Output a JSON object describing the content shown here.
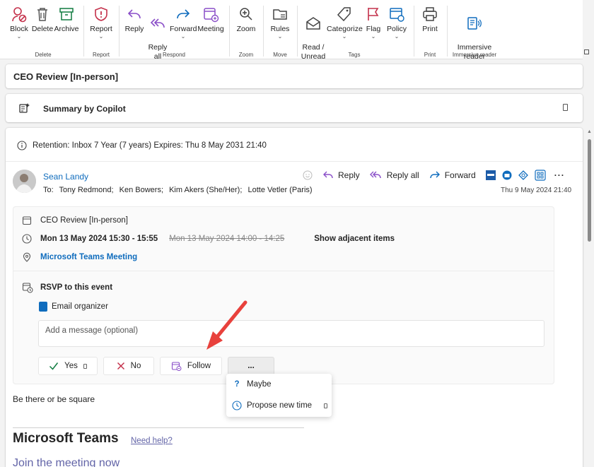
{
  "ribbon": {
    "groups": [
      {
        "name": "Delete",
        "buttons": [
          {
            "label": "Block",
            "icon": "block-icon",
            "chevron": true
          },
          {
            "label": "Delete",
            "icon": "delete-icon"
          },
          {
            "label": "Archive",
            "icon": "archive-icon"
          }
        ]
      },
      {
        "name": "Report",
        "buttons": [
          {
            "label": "Report",
            "icon": "report-icon",
            "chevron": true
          }
        ]
      },
      {
        "name": "Respond",
        "buttons": [
          {
            "label": "Reply",
            "icon": "reply-icon"
          },
          {
            "label": "Reply\nall",
            "icon": "reply-all-icon"
          },
          {
            "label": "Forward",
            "icon": "forward-icon",
            "chevron": true
          },
          {
            "label": "Meeting",
            "icon": "meeting-icon"
          }
        ]
      },
      {
        "name": "Zoom",
        "buttons": [
          {
            "label": "Zoom",
            "icon": "zoom-icon"
          }
        ]
      },
      {
        "name": "Move",
        "buttons": [
          {
            "label": "Rules",
            "icon": "rules-icon",
            "chevron": true
          }
        ]
      },
      {
        "name": "Tags",
        "buttons": [
          {
            "label": "Read /\nUnread",
            "icon": "read-unread-icon"
          },
          {
            "label": "Categorize",
            "icon": "categorize-icon",
            "chevron": true
          },
          {
            "label": "Flag",
            "icon": "flag-icon",
            "chevron": true
          },
          {
            "label": "Policy",
            "icon": "policy-icon",
            "chevron": true
          }
        ]
      },
      {
        "name": "Print",
        "buttons": [
          {
            "label": "Print",
            "icon": "print-icon"
          }
        ]
      },
      {
        "name": "Immersive reader",
        "buttons": [
          {
            "label": "Immersive\nreader",
            "icon": "immersive-reader-icon"
          }
        ]
      }
    ]
  },
  "subject": "CEO Review [In-person]",
  "copilot": {
    "label": "Summary by Copilot"
  },
  "retention": "Retention: Inbox 7 Year (7 years) Expires: Thu 8 May 2031 21:40",
  "message": {
    "sender": "Sean Landy",
    "to_label": "To:",
    "recipients": [
      "Tony Redmond;",
      "Ken Bowers;",
      "Kim Akers (She/Her);",
      "Lotte Vetler (Paris)"
    ],
    "date": "Thu 9 May 2024 21:40",
    "actions": {
      "reply": "Reply",
      "reply_all": "Reply all",
      "forward": "Forward"
    }
  },
  "meeting": {
    "title": "CEO Review [In-person]",
    "time_new": "Mon 13 May 2024 15:30 - 15:55",
    "time_old": "Mon 13 May 2024 14:00 - 14:25",
    "show_adjacent": "Show adjacent items",
    "location": "Microsoft Teams Meeting",
    "rsvp_title": "RSVP to this event",
    "email_organizer": "Email organizer",
    "message_placeholder": "Add a message (optional)",
    "buttons": {
      "yes": "Yes",
      "no": "No",
      "follow": "Follow",
      "more": "..."
    },
    "dropdown": {
      "maybe": "Maybe",
      "propose": "Propose new time"
    }
  },
  "body": {
    "text": "Be there or be square",
    "teams_heading": "Microsoft Teams",
    "need_help": "Need help?",
    "join": "Join the meeting now"
  },
  "colors": {
    "accent": "#0f6cbd",
    "teams": "#6264a7",
    "ribbon_icon": "#6b3fa0",
    "alert_red": "#c4314b",
    "arrow": "#e8413c"
  }
}
